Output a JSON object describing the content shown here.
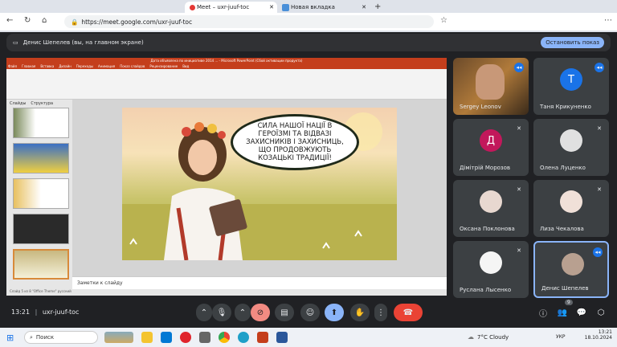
{
  "browser": {
    "tabs": [
      {
        "label": "Meet – uxr-juuf-toc",
        "active": true
      },
      {
        "label": "Новая вкладка",
        "active": false
      }
    ],
    "url": "https://meet.google.com/uxr-juuf-toc"
  },
  "presenting_bar": {
    "text": "Денис Шепелев (вы, на главном экране)",
    "stop_label": "Остановить показ"
  },
  "ppt": {
    "title": "Дата объявлена по инициативе 2014 ... - Microsoft PowerPoint (Сбой активации продукта)",
    "menu": [
      "Файл",
      "Главная",
      "Вставка",
      "Дизайн",
      "Переходы",
      "Анимация",
      "Показ слайдов",
      "Рецензирование",
      "Вид"
    ],
    "panel_tabs": [
      "Слайды",
      "Структура"
    ],
    "bubble_text": "СИЛА НАШОЇ НАЦІЇ В ГЕРОЇЗМІ ТА ВІДВАЗІ ЗАХИСНИКІВ І ЗАХИСНИЦЬ, ЩО ПРОДОВЖУЮТЬ КОЗАЦЬКІ ТРАДИЦІЇ!",
    "notes_placeholder": "Заметки к слайду",
    "status": "Слайд 5 из 8   \"Office Theme\"   русский"
  },
  "participants": [
    {
      "name": "Sergey Leonov",
      "speaking": true,
      "video": true
    },
    {
      "name": "Таня Крикуненко",
      "initial": "Т",
      "color": "#1a73e8",
      "speaking": true
    },
    {
      "name": "Дімітрій Морозов",
      "initial": "Д",
      "color": "#c2185b",
      "muted": true
    },
    {
      "name": "Олена Луценко",
      "muted": true
    },
    {
      "name": "Оксана Поклонова",
      "muted": true
    },
    {
      "name": "Лиза Чекалова",
      "muted": true
    },
    {
      "name": "Руслана Лысенко",
      "muted": true
    },
    {
      "name": "Денис Шепелев",
      "speaking": true,
      "active": true
    }
  ],
  "footer": {
    "time": "13:21",
    "meeting_code": "uxr-juuf-toc",
    "participant_count": "9"
  },
  "taskbar": {
    "search_label": "Поиск",
    "weather": "7°C  Cloudy",
    "lang": "УКР",
    "clock_time": "13:21",
    "clock_date": "18.10.2024"
  }
}
